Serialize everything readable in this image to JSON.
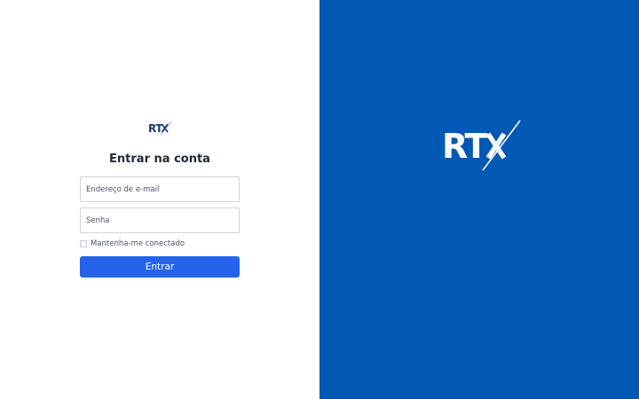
{
  "brand": {
    "name": "RTX",
    "logo_icon": "rtx-logo-icon"
  },
  "login": {
    "title": "Entrar na conta",
    "email_placeholder": "Endereço de e-mail",
    "email_value": "",
    "password_placeholder": "Senha",
    "password_value": "",
    "remember_label": "Mantenha-me conectado",
    "remember_checked": false,
    "submit_label": "Entrar"
  },
  "colors": {
    "brand_panel": "#0258b5",
    "primary_button": "#2563eb",
    "logo_dark": "#1f3b6e",
    "logo_accent": "#2563eb"
  }
}
